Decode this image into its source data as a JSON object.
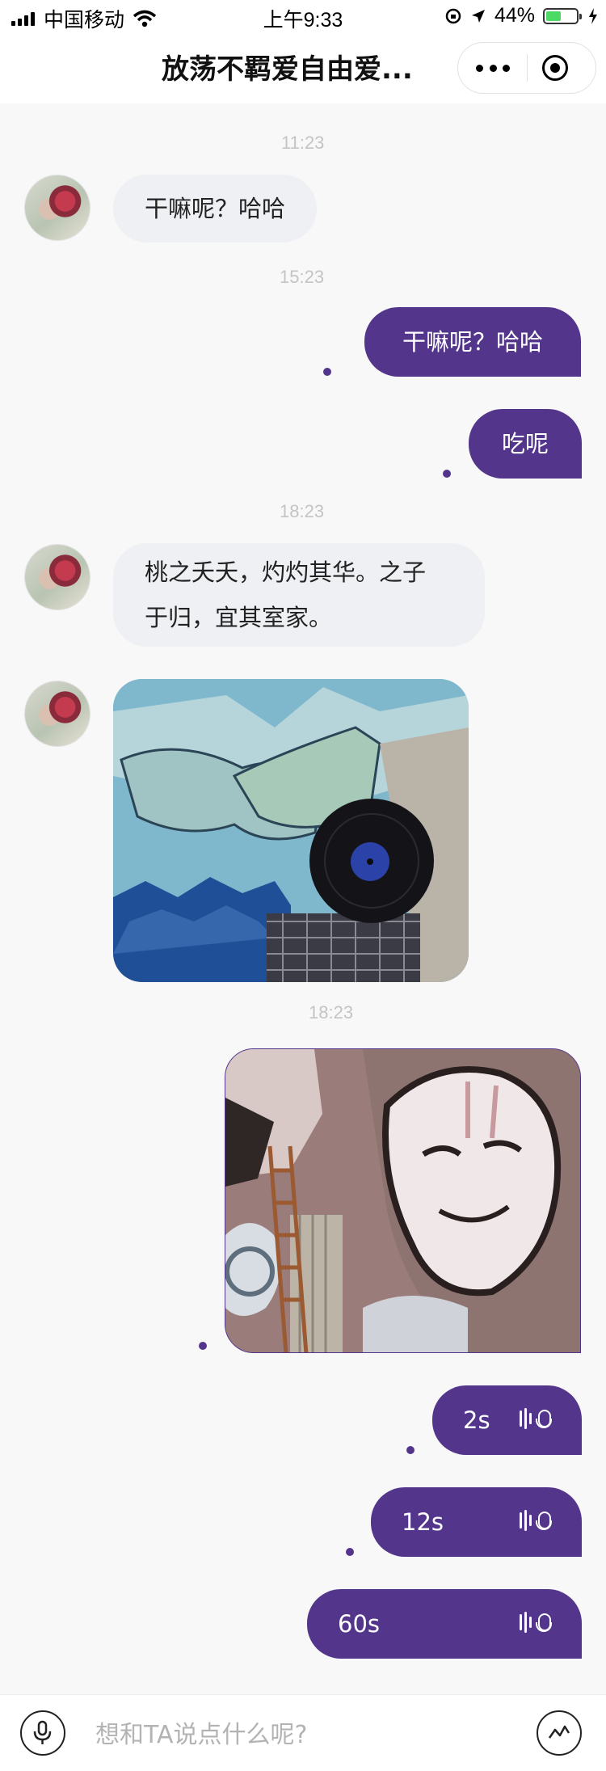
{
  "status_bar": {
    "carrier": "中国移动",
    "time": "上午9:33",
    "battery": "44%",
    "icons": [
      "signal-icon",
      "wifi-icon",
      "rotation-lock-icon",
      "location-icon",
      "battery-icon",
      "charging-icon"
    ]
  },
  "nav": {
    "title": "放荡不羁爱自由爱...",
    "more_icon": "more-dots-icon",
    "close_icon": "close-target-icon"
  },
  "messages": {
    "t1": "11:23",
    "m1": "干嘛呢？哈哈",
    "t2": "15:23",
    "m2": "干嘛呢？哈哈",
    "m3": "吃呢",
    "t3": "18:23",
    "m4_line1": "桃之夭夭，灼灼其华。之子",
    "m4_line2": "于归，宜其室家。",
    "t4": "18:23",
    "v1": "2s",
    "v2": "12s",
    "v3": "60s"
  },
  "input": {
    "placeholder": "想和TA说点什么呢?",
    "voice_icon": "microphone-icon",
    "emoji_icon": "chart-emoji-icon"
  },
  "colors": {
    "accent": "#53368c",
    "bubble_left": "#eef0f3",
    "background": "#f8f8f8"
  }
}
